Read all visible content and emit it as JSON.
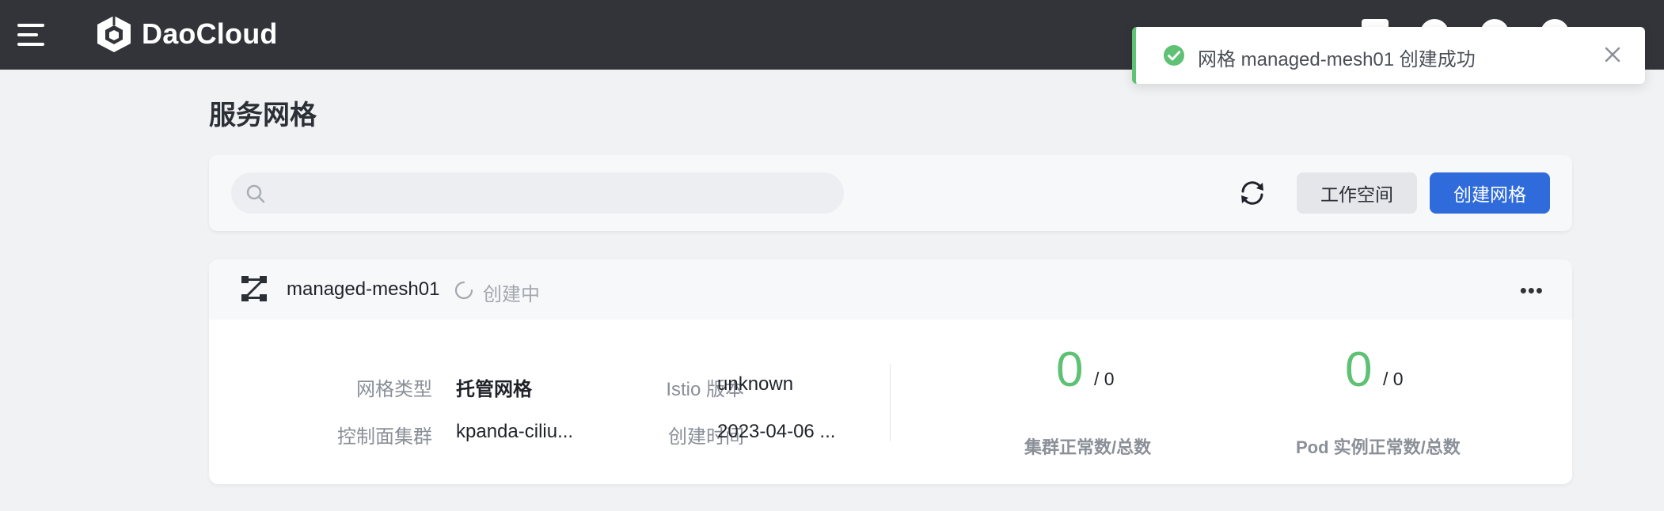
{
  "header": {
    "brand": "DaoCloud",
    "icons": [
      "menu-icon",
      "logo-cube-icon",
      "doc-icon",
      "help-icon",
      "bell-icon",
      "user-icon"
    ]
  },
  "page": {
    "title": "服务网格"
  },
  "toolbar": {
    "search_placeholder": "",
    "refresh_icon": "refresh-icon",
    "workspace_label": "工作空间",
    "create_label": "创建网格"
  },
  "mesh": {
    "name": "managed-mesh01",
    "status": "创建中",
    "fields": {
      "type_label": "网格类型",
      "type_value": "托管网格",
      "cluster_label": "控制面集群",
      "cluster_value": "kpanda-ciliu...",
      "istio_label": "Istio 版本",
      "istio_value": "unknown",
      "created_label": "创建时间",
      "created_value": "2023-04-06 ..."
    },
    "stats": {
      "cluster_healthy": "0",
      "cluster_total": "/ 0",
      "cluster_label": "集群正常数/总数",
      "pod_healthy": "0",
      "pod_total": "/ 0",
      "pod_label": "Pod 实例正常数/总数"
    }
  },
  "toast": {
    "message": "网格 managed-mesh01 创建成功"
  },
  "colors": {
    "topbar": "#333439",
    "primary": "#2f6bdb",
    "success": "#5ec174"
  }
}
